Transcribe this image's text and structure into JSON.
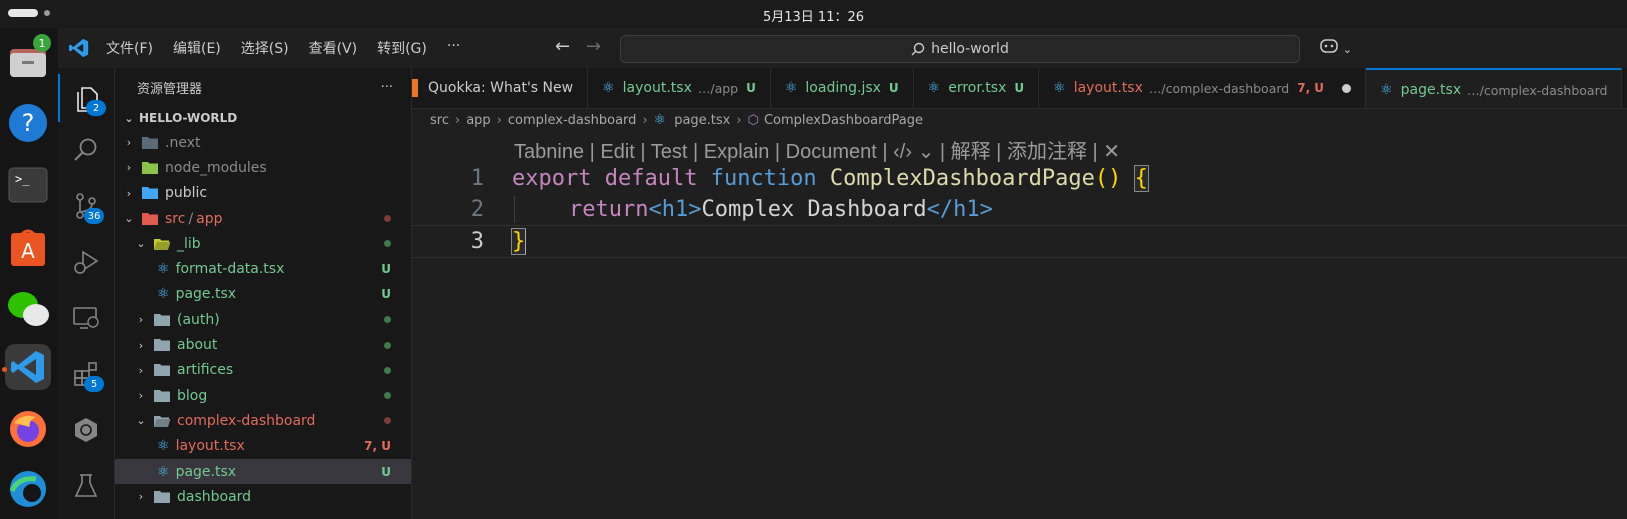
{
  "system": {
    "clock": "5月13日  11：26"
  },
  "dock": {
    "apps": [
      {
        "name": "files",
        "badge": "1"
      },
      {
        "name": "help"
      },
      {
        "name": "terminal"
      },
      {
        "name": "app-center"
      },
      {
        "name": "wechat"
      },
      {
        "name": "vscode"
      },
      {
        "name": "firefox"
      },
      {
        "name": "edge"
      }
    ]
  },
  "titlebar": {
    "menu": [
      "文件(F)",
      "编辑(E)",
      "选择(S)",
      "查看(V)",
      "转到(G)",
      "···"
    ],
    "search": "hello-world"
  },
  "activity": {
    "explorer_badge": "2",
    "scm_badge": "36",
    "extensions_badge": "5"
  },
  "sidebar": {
    "title": "资源管理器",
    "more": "···",
    "root": "HELLO-WORLD",
    "tree": [
      {
        "label": ".next",
        "icon": "folder-next",
        "chev": "›",
        "indent": 1,
        "color": "#8a8a8a",
        "status": ""
      },
      {
        "label": "node_modules",
        "icon": "folder-node",
        "chev": "›",
        "indent": 1,
        "color": "#8a8a8a",
        "status": ""
      },
      {
        "label": "public",
        "icon": "folder-public",
        "chev": "›",
        "indent": 1,
        "color": "#cccccc",
        "status": ""
      },
      {
        "label": "src",
        "label2": "app",
        "icon": "folder-src",
        "chev": "⌄",
        "indent": 1,
        "color": "#e06c5b",
        "status": "dot-r"
      },
      {
        "label": "_lib",
        "icon": "folder-lib",
        "chev": "⌄",
        "indent": 2,
        "color": "#73c991",
        "status": "dot-g"
      },
      {
        "label": "format-data.tsx",
        "icon": "react",
        "chev": "",
        "indent": 3,
        "color": "#73c991",
        "status": "U"
      },
      {
        "label": "page.tsx",
        "icon": "react",
        "chev": "",
        "indent": 3,
        "color": "#73c991",
        "status": "U"
      },
      {
        "label": "(auth)",
        "icon": "folder",
        "chev": "›",
        "indent": 2,
        "color": "#73c991",
        "status": "dot-g"
      },
      {
        "label": "about",
        "icon": "folder",
        "chev": "›",
        "indent": 2,
        "color": "#73c991",
        "status": "dot-g"
      },
      {
        "label": "artifices",
        "icon": "folder",
        "chev": "›",
        "indent": 2,
        "color": "#73c991",
        "status": "dot-g"
      },
      {
        "label": "blog",
        "icon": "folder",
        "chev": "›",
        "indent": 2,
        "color": "#73c991",
        "status": "dot-g"
      },
      {
        "label": "complex-dashboard",
        "icon": "folder-open",
        "chev": "⌄",
        "indent": 2,
        "color": "#e06c5b",
        "status": "dot-r"
      },
      {
        "label": "layout.tsx",
        "icon": "react",
        "chev": "",
        "indent": 3,
        "color": "#e06c5b",
        "status": "7, U"
      },
      {
        "label": "page.tsx",
        "icon": "react",
        "chev": "",
        "indent": 3,
        "color": "#73c991",
        "status": "U",
        "selected": true
      },
      {
        "label": "dashboard",
        "icon": "folder",
        "chev": "›",
        "indent": 2,
        "color": "#73c991",
        "status": ""
      }
    ]
  },
  "tabs": [
    {
      "label": "Quokka: What's New",
      "desc": "",
      "flag": "",
      "color": "#cccccc",
      "icon": "quokka"
    },
    {
      "label": "layout.tsx",
      "desc": "…/app",
      "flag": "U",
      "color": "#73c991",
      "icon": "react"
    },
    {
      "label": "loading.jsx",
      "desc": "",
      "flag": "U",
      "color": "#73c991",
      "icon": "react"
    },
    {
      "label": "error.tsx",
      "desc": "",
      "flag": "U",
      "color": "#73c991",
      "icon": "react"
    },
    {
      "label": "layout.tsx",
      "desc": "…/complex-dashboard",
      "flag": "7, U",
      "color": "#e06c5b",
      "icon": "react",
      "dirty": true
    },
    {
      "label": "page.tsx",
      "desc": "…/complex-dashboard",
      "flag": "",
      "color": "#73c991",
      "icon": "react",
      "active": true
    }
  ],
  "breadcrumb": [
    "src",
    "app",
    "complex-dashboard",
    "page.tsx",
    "ComplexDashboardPage"
  ],
  "codelens": "Tabnine | Edit | Test | Explain | Document | ‹/› ⌄ | 解释 | 添加注释 | ✕",
  "code": {
    "line_numbers": [
      "1",
      "2",
      "3"
    ],
    "l1": {
      "kw1": "export",
      "kw2": "default",
      "kw3": "function",
      "fn": "ComplexDashboardPage",
      "paren": "()",
      "brace": "{"
    },
    "l2": {
      "kw": "return",
      "open": "<h1>",
      "text": "Complex Dashboard",
      "close": "</h1>"
    },
    "l3": {
      "brace": "}"
    }
  }
}
